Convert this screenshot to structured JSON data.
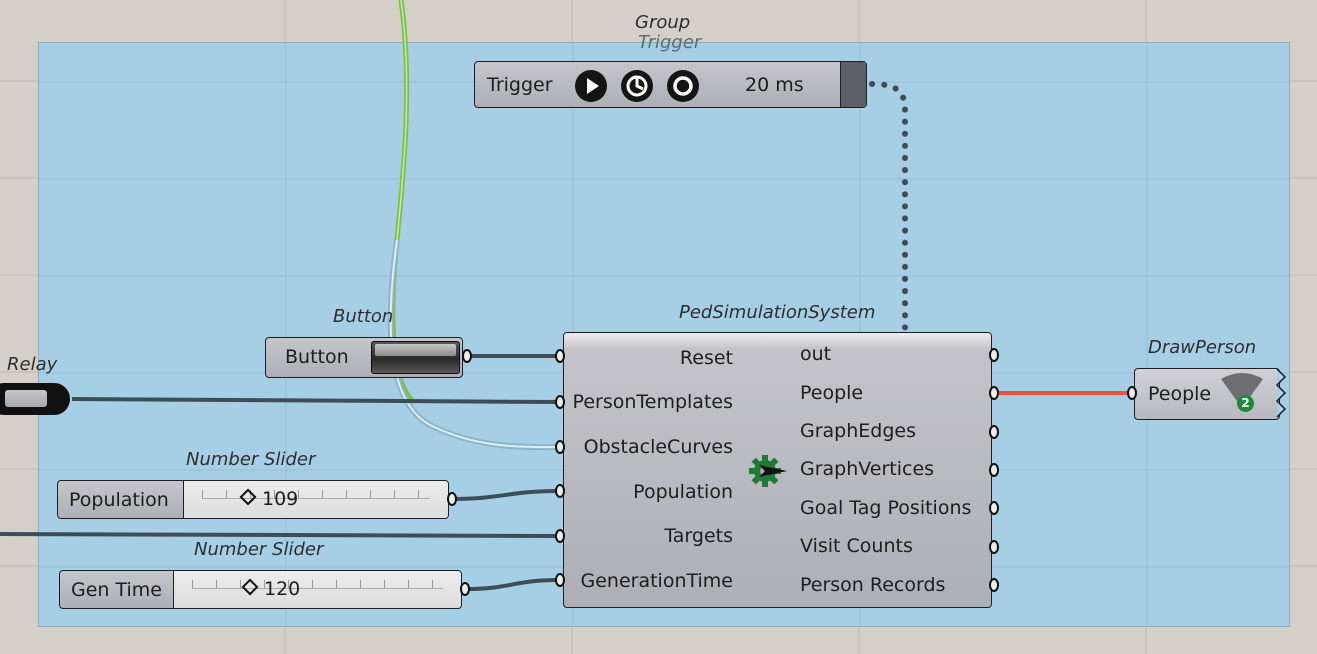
{
  "groups": {
    "main_group_caption": "Group",
    "trigger_group_caption": "Trigger"
  },
  "trigger": {
    "caption": "Trigger",
    "label": "Trigger",
    "interval": "20 ms",
    "buttons": [
      "play-icon",
      "step-timer-icon",
      "stop-icon"
    ]
  },
  "button": {
    "caption": "Button",
    "label": "Button"
  },
  "relay": {
    "caption": "Relay"
  },
  "population_slider": {
    "caption": "Number Slider",
    "label": "Population",
    "value": "109"
  },
  "gentime_slider": {
    "caption": "Number Slider",
    "label": "Gen Time",
    "value": "120"
  },
  "ped_system": {
    "caption": "PedSimulationSystem",
    "inputs": [
      "Reset",
      "PersonTemplates",
      "ObstacleCurves",
      "Population",
      "Targets",
      "GenerationTime"
    ],
    "outputs": [
      "out",
      "People",
      "GraphEdges",
      "GraphVertices",
      "Goal Tag Positions",
      "Visit Counts",
      "Person Records"
    ],
    "icon": "pedestrian-gear-icon"
  },
  "draw_person": {
    "caption": "DrawPerson",
    "input": "People",
    "badge": "2",
    "icon": "person-fan-icon"
  },
  "colors": {
    "canvas": "#d4d0c8",
    "group_fill": "#a6cfe6",
    "wire": "#3f4d58",
    "selected_wire": "#e8553b",
    "green_wire": "#7cc142"
  }
}
